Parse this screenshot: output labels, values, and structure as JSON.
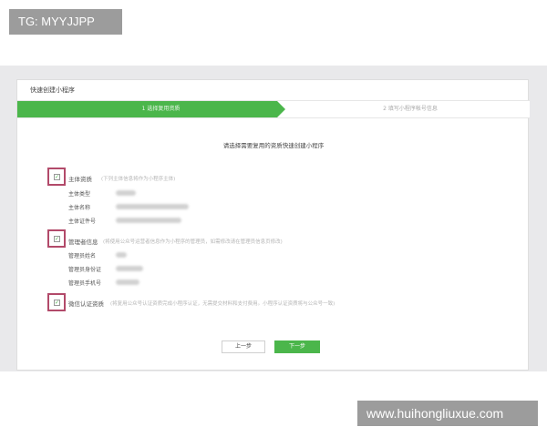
{
  "watermark_top": "TG: MYYJJPP",
  "watermark_bottom": "www.huihongliuxue.com",
  "panel": {
    "title": "快速创建小程序",
    "steps": [
      {
        "label": "1 选择复用资质",
        "active": true
      },
      {
        "label": "2 填写小程序帐号信息",
        "active": false
      }
    ],
    "intro": "请选择需要复用的资质快速创建小程序",
    "sections": [
      {
        "title": "主体资质",
        "hint": "(下列主体信息将作为小程序主体)",
        "rows": [
          "主体类型",
          "主体名称",
          "主体证件号"
        ]
      },
      {
        "title": "管理者信息",
        "hint": "(将使用公众号运营者信息作为小程序的管理员，如需修改请在管理员信息页修改)",
        "rows": [
          "管理员姓名",
          "管理员身份证",
          "管理员手机号"
        ]
      },
      {
        "title": "微信认证资质",
        "hint": "(将复用公众号认证资质完成小程序认证，无需提交材料和支付费用。小程序认证资质将与公众号一致)",
        "rows": []
      }
    ],
    "buttons": {
      "prev": "上一步",
      "next": "下一步"
    }
  },
  "colors": {
    "accent": "#4bb64b",
    "highlight_box": "#b24a6a",
    "backdrop": "#e9e9eb"
  }
}
